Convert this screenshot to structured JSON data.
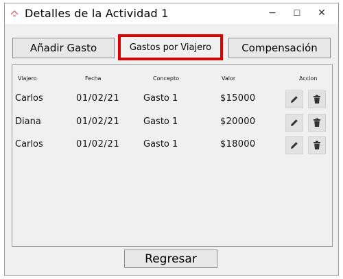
{
  "window": {
    "title": "Detalles de la Actividad 1",
    "minimize_symbol": "−",
    "maximize_symbol": "☐",
    "close_symbol": "✕"
  },
  "toolbar": {
    "add_expense_label": "Añadir Gasto",
    "expenses_by_traveler_label": "Gastos por Viajero",
    "compensation_label": "Compensación"
  },
  "table": {
    "headers": {
      "traveler": "Viajero",
      "date": "Fecha",
      "concept": "Concepto",
      "value": "Valor",
      "action": "Accion"
    },
    "rows": [
      {
        "traveler": "Carlos",
        "date": "01/02/21",
        "concept": "Gasto 1",
        "value": "$15000"
      },
      {
        "traveler": "Diana",
        "date": "01/02/21",
        "concept": "Gasto 1",
        "value": "$20000"
      },
      {
        "traveler": "Carlos",
        "date": "01/02/21",
        "concept": "Gasto 1",
        "value": "$18000"
      }
    ]
  },
  "footer": {
    "back_label": "Regresar"
  },
  "icons": {
    "edit": "pencil-icon",
    "delete": "trash-icon"
  },
  "colors": {
    "highlight": "#dd0000",
    "window_bg": "#f0f0f0",
    "button_bg": "#e8e8e8"
  }
}
